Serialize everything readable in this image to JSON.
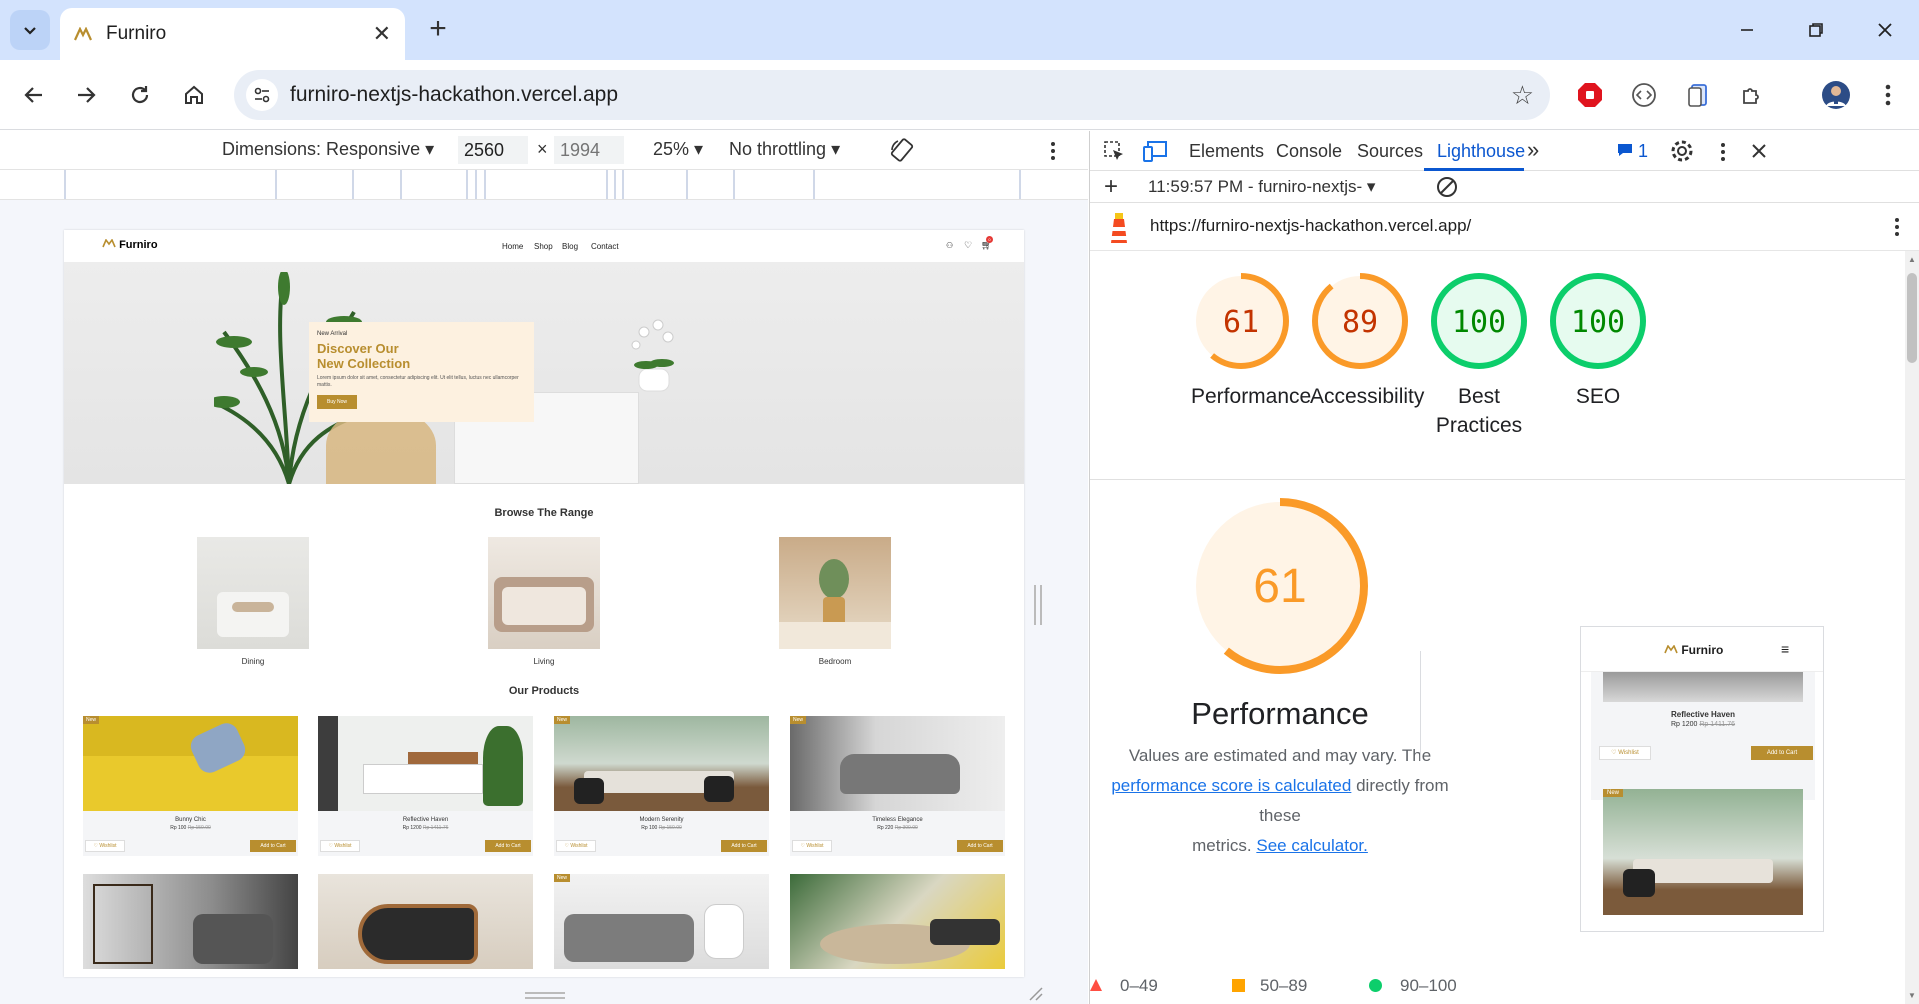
{
  "tab": {
    "title": "Furniro"
  },
  "address": {
    "url": "furniro-nextjs-hackathon.vercel.app"
  },
  "device_toolbar": {
    "dimensions_label": "Dimensions: Responsive",
    "width": "2560",
    "height_placeholder": "1994",
    "times": "×",
    "zoom": "25%",
    "throttling": "No throttling"
  },
  "site": {
    "brand": "Furniro",
    "nav": [
      "Home",
      "Shop",
      "Blog",
      "Contact"
    ],
    "cart_count": "0",
    "hero": {
      "eyebrow": "New Arrival",
      "heading_line1": "Discover Our",
      "heading_line2": "New Collection",
      "body": "Lorem ipsum dolor sit amet, consectetur adipiscing elit. Ut elit tellus, luctus nec ullamcorper mattis.",
      "cta": "Buy Now"
    },
    "browse_title": "Browse The Range",
    "ranges": [
      "Dining",
      "Living",
      "Bedroom"
    ],
    "products_title": "Our Products",
    "products": [
      {
        "name": "Bunny Chic",
        "price": "Rp 100",
        "old": "Rp 150.00",
        "badge": "New",
        "wish": "Wishlist",
        "cart": "Add to Cart"
      },
      {
        "name": "Reflective Haven",
        "price": "Rp 1200",
        "old": "Rp 1411.76",
        "badge": "",
        "wish": "Wishlist",
        "cart": "Add to Cart"
      },
      {
        "name": "Modern Serenity",
        "price": "Rp 100",
        "old": "Rp 150.00",
        "badge": "New",
        "wish": "Wishlist",
        "cart": "Add to Cart"
      },
      {
        "name": "Timeless Elegance",
        "price": "Rp 220",
        "old": "Rp 300.00",
        "badge": "New",
        "wish": "Wishlist",
        "cart": "Add to Cart"
      }
    ],
    "row2_badges": [
      "",
      "",
      "New",
      ""
    ]
  },
  "devtools": {
    "tabs": [
      "Elements",
      "Console",
      "Sources",
      "Lighthouse"
    ],
    "issues_count": "1",
    "report_select": "11:59:57 PM - furniro-nextjs-",
    "report_url": "https://furniro-nextjs-hackathon.vercel.app/",
    "scores": [
      {
        "value": "61",
        "label": "Performance",
        "level": 0.61,
        "color": "#fa9a28"
      },
      {
        "value": "89",
        "label": "Accessibility",
        "level": 0.89,
        "color": "#fa9a28"
      },
      {
        "value": "100",
        "label": "Best Practices",
        "level": 1.0,
        "color": "#0cce6b"
      },
      {
        "value": "100",
        "label": "SEO",
        "level": 1.0,
        "color": "#0cce6b"
      }
    ],
    "big_score": "61",
    "big_title": "Performance",
    "note_line1": "Values are estimated and may vary. The",
    "note_link": "performance score is calculated",
    "note_after_link": " directly from these",
    "note_line3": "metrics.",
    "calc_link": "See calculator.",
    "legend": [
      "0–49",
      "50–89",
      "90–100"
    ],
    "thumb": {
      "brand": "Furniro",
      "product_name": "Reflective Haven",
      "product_price": "Rp 1200",
      "product_old": "Rp 1411.76",
      "wish": "Wishlist",
      "cart": "Add to Cart",
      "badge": "New"
    }
  },
  "colors": {
    "accent": "#b88e2f",
    "lh_blue": "#0b57d0",
    "tab_strip": "#d3e3fd"
  }
}
